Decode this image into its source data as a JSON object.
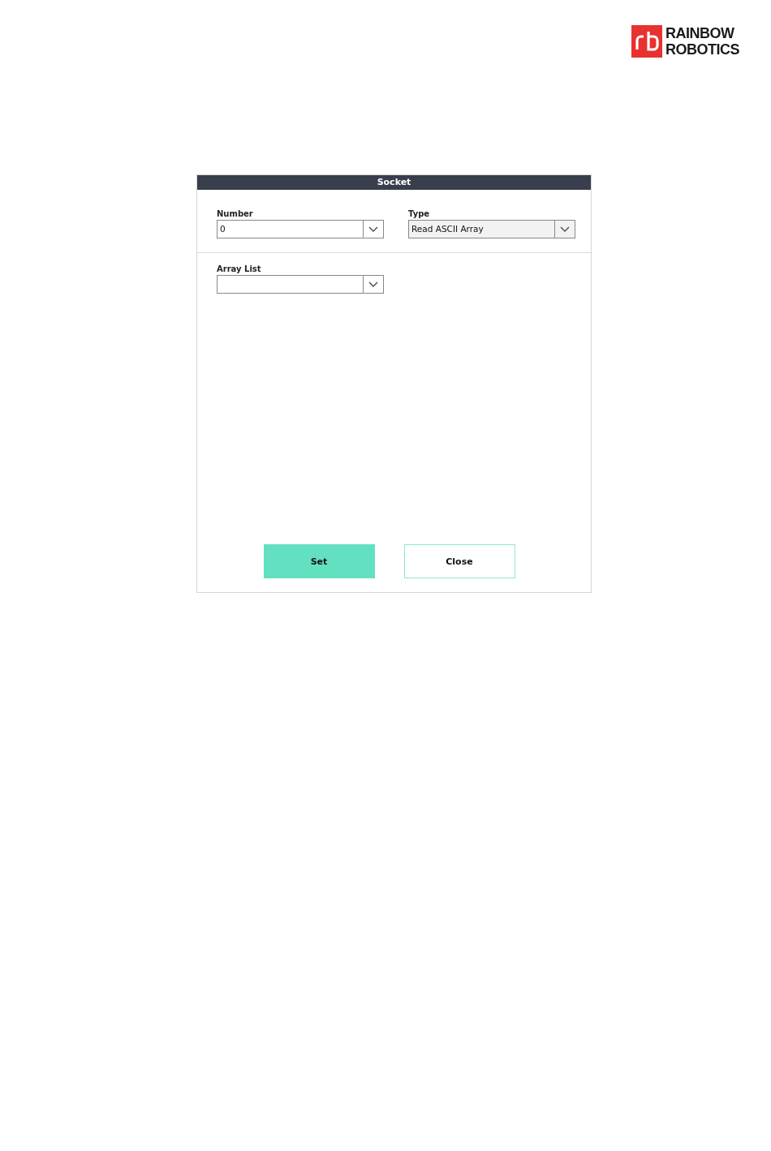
{
  "logo": {
    "lines": [
      "RAINBOW",
      "ROBOTICS"
    ]
  },
  "dialog": {
    "title": "Socket",
    "fields": [
      {
        "label": "Number",
        "value": "0",
        "disabled": false
      },
      {
        "label": "Type",
        "value": "Read ASCII Array",
        "disabled": true
      },
      {
        "label": "Array List",
        "disabled": false
      }
    ],
    "buttons": [
      {
        "label": "Set",
        "kind": "primary"
      },
      {
        "label": "Close",
        "kind": "outline"
      }
    ]
  }
}
